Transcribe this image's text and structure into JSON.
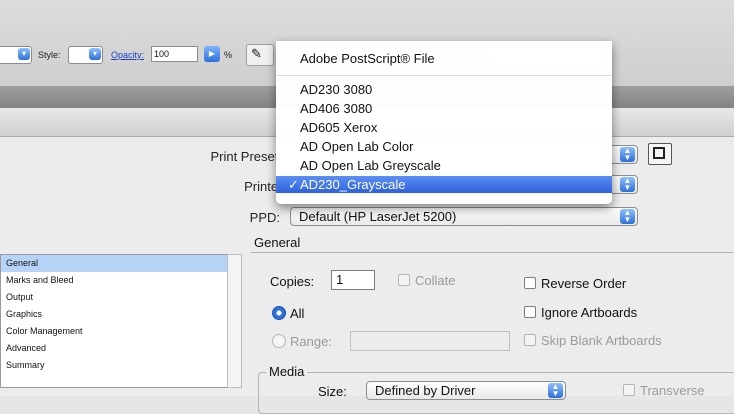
{
  "toolbar": {
    "style_label": "Style:",
    "opacity_label": "Opacity:",
    "opacity_value": "100",
    "percent": "%"
  },
  "dialog": {
    "print_preset_label": "Print Preset:",
    "printer_label": "Printer:",
    "ppd_label": "PPD:",
    "ppd_value": "Default (HP LaserJet 5200)",
    "general_heading": "General"
  },
  "sections": [
    "General",
    "Marks and Bleed",
    "Output",
    "Graphics",
    "Color Management",
    "Advanced",
    "Summary"
  ],
  "general": {
    "copies_label": "Copies:",
    "copies_value": "1",
    "collate_label": "Collate",
    "reverse_order_label": "Reverse Order",
    "all_label": "All",
    "ignore_artboards_label": "Ignore Artboards",
    "range_label": "Range:",
    "skip_blank_label": "Skip Blank Artboards"
  },
  "media": {
    "legend": "Media",
    "size_label": "Size:",
    "size_value": "Defined by Driver",
    "transverse_label": "Transverse"
  },
  "printer_menu": {
    "items": [
      "Adobe PostScript® File",
      "AD230 3080",
      "AD406 3080",
      "AD605 Xerox",
      "AD Open Lab Color",
      "AD Open Lab Greyscale",
      "AD230_Grayscale"
    ],
    "checkmark": "✓",
    "selected_index": 6
  },
  "colors": {
    "menu_highlight": "#2d62dc",
    "list_selection": "#b7d3f7",
    "stepper_blue": "#2f6fd6"
  }
}
